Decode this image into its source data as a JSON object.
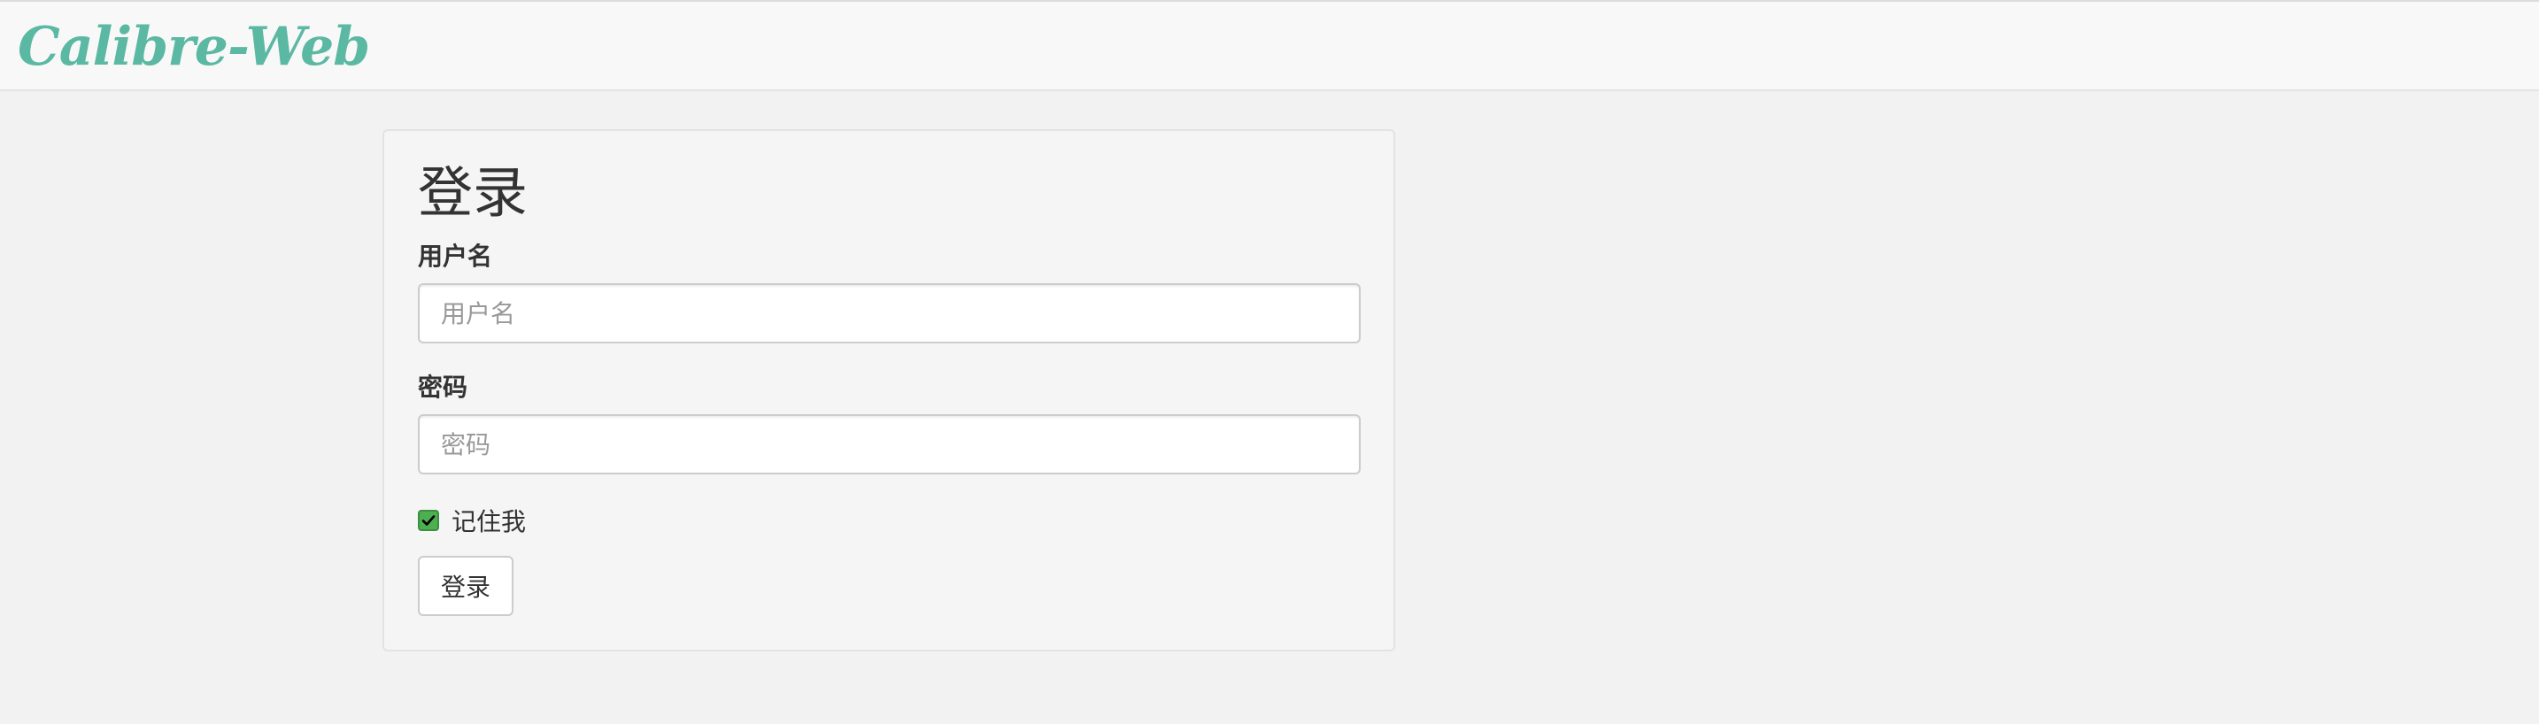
{
  "app": {
    "brand": "Calibre-Web",
    "brand_color": "#5bb8a3"
  },
  "login": {
    "title": "登录",
    "username": {
      "label": "用户名",
      "placeholder": "用户名",
      "value": ""
    },
    "password": {
      "label": "密码",
      "placeholder": "密码",
      "value": ""
    },
    "remember_me": {
      "label": "记住我",
      "checked": true,
      "color": "#4caf50"
    },
    "submit_label": "登录"
  }
}
